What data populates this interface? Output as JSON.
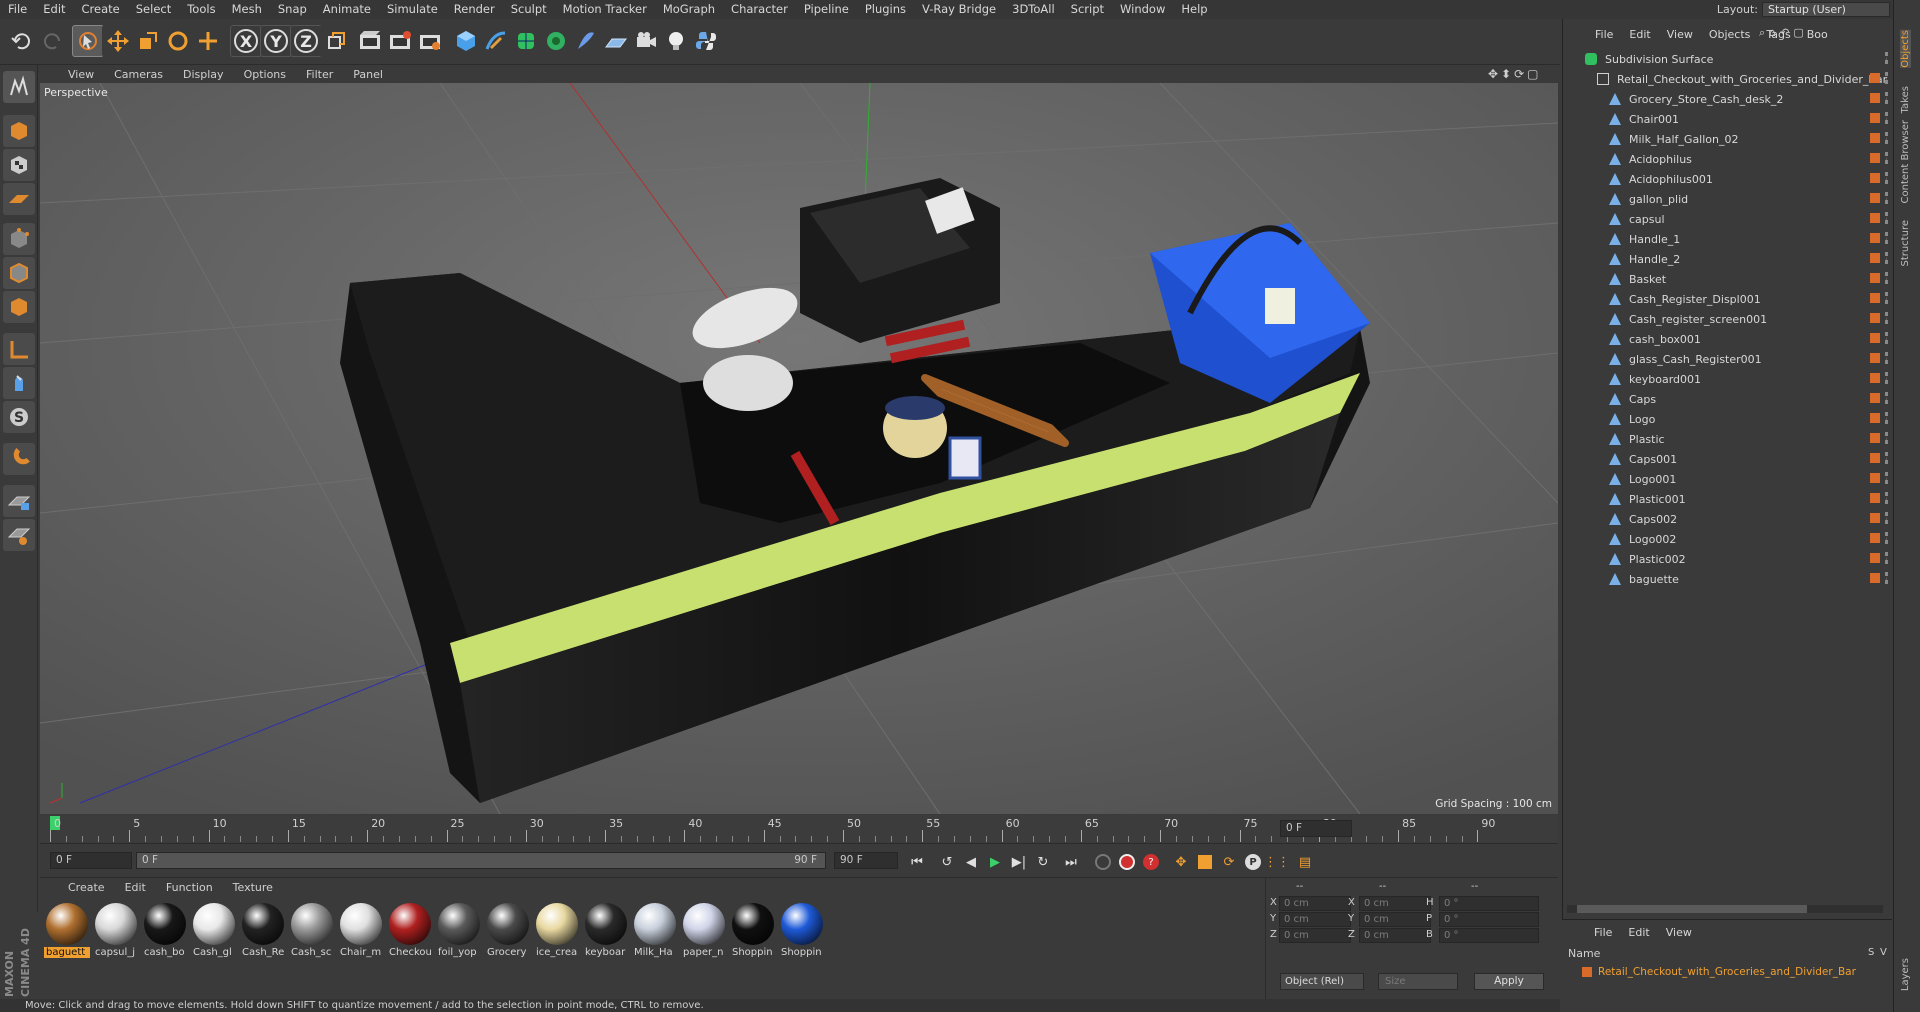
{
  "menubar": {
    "items": [
      "File",
      "Edit",
      "Create",
      "Select",
      "Tools",
      "Mesh",
      "Snap",
      "Animate",
      "Simulate",
      "Render",
      "Sculpt",
      "Motion Tracker",
      "MoGraph",
      "Character",
      "Pipeline",
      "Plugins",
      "V-Ray Bridge",
      "3DToAll",
      "Script",
      "Window",
      "Help"
    ],
    "layout_label": "Layout:",
    "layout_value": "Startup (User)"
  },
  "toolbar": {
    "axis_x": "X",
    "axis_y": "Y",
    "axis_z": "Z"
  },
  "viewport": {
    "menu": [
      "View",
      "Cameras",
      "Display",
      "Options",
      "Filter",
      "Panel"
    ],
    "camera_label": "Perspective",
    "grid_spacing": "Grid Spacing : 100 cm"
  },
  "timeline": {
    "ticks": [
      "0",
      "5",
      "10",
      "15",
      "20",
      "25",
      "30",
      "35",
      "40",
      "45",
      "50",
      "55",
      "60",
      "65",
      "70",
      "75",
      "80",
      "85",
      "90"
    ],
    "current_frame": "0 F",
    "start_field": "0 F",
    "range_start": "0 F",
    "range_end": "90 F",
    "end_field": "90 F"
  },
  "materials": {
    "menu": [
      "Create",
      "Edit",
      "Function",
      "Texture"
    ],
    "items": [
      {
        "name": "baguett",
        "color": "#b07030",
        "selected": true
      },
      {
        "name": "capsul_j",
        "color": "#d8d8d8",
        "selected": false
      },
      {
        "name": "cash_bo",
        "color": "#181818",
        "selected": false
      },
      {
        "name": "Cash_gl",
        "color": "#e8e8e8",
        "selected": false
      },
      {
        "name": "Cash_Re",
        "color": "#222222",
        "selected": false
      },
      {
        "name": "Cash_sc",
        "color": "#9a9a9a",
        "selected": false
      },
      {
        "name": "Chair_m",
        "color": "#e0e0e0",
        "selected": false
      },
      {
        "name": "Checkou",
        "color": "#b02020",
        "selected": false
      },
      {
        "name": "foil_yop",
        "color": "#5a5a5a",
        "selected": false
      },
      {
        "name": "Grocery",
        "color": "#4a4a4a",
        "selected": false
      },
      {
        "name": "ice_crea",
        "color": "#e8d8a0",
        "selected": false
      },
      {
        "name": "keyboar",
        "color": "#2a2a2a",
        "selected": false
      },
      {
        "name": "Milk_Ha",
        "color": "#c8d0dc",
        "selected": false
      },
      {
        "name": "paper_n",
        "color": "#d0d4e8",
        "selected": false
      },
      {
        "name": "Shoppin",
        "color": "#101010",
        "selected": false
      },
      {
        "name": "Shoppin",
        "color": "#1e5ad8",
        "selected": false
      }
    ]
  },
  "coords": {
    "head": [
      "--",
      "--",
      "--"
    ],
    "rows": [
      {
        "a": "X",
        "av": "0 cm",
        "b": "X",
        "bv": "0 cm",
        "c": "H",
        "cv": "0 °"
      },
      {
        "a": "Y",
        "av": "0 cm",
        "b": "Y",
        "bv": "0 cm",
        "c": "P",
        "cv": "0 °"
      },
      {
        "a": "Z",
        "av": "0 cm",
        "b": "Z",
        "bv": "0 cm",
        "c": "B",
        "cv": "0 °"
      }
    ],
    "mode": "Object (Rel)",
    "size": "Size",
    "apply": "Apply"
  },
  "status": "Move: Click and drag to move elements. Hold down SHIFT to quantize movement / add to the selection in point mode, CTRL to remove.",
  "objects": {
    "menu": [
      "File",
      "Edit",
      "View",
      "Objects",
      "Tags",
      "Boo"
    ],
    "root": "Subdivision Surface",
    "group": "Retail_Checkout_with_Groceries_and_Divider_Bar",
    "children": [
      "Grocery_Store_Cash_desk_2",
      "Chair001",
      "Milk_Half_Gallon_02",
      "Acidophilus",
      "Acidophilus001",
      "gallon_plid",
      "capsul",
      "Handle_1",
      "Handle_2",
      "Basket",
      "Cash_Register_Displ001",
      "Cash_register_screen001",
      "cash_box001",
      "glass_Cash_Register001",
      "keyboard001",
      "Caps",
      "Logo",
      "Plastic",
      "Caps001",
      "Logo001",
      "Plastic001",
      "Caps002",
      "Logo002",
      "Plastic002",
      "baguette"
    ]
  },
  "layers": {
    "menu": [
      "File",
      "Edit",
      "View"
    ],
    "col_name": "Name",
    "col_s": "S",
    "col_v": "V",
    "item": "Retail_Checkout_with_Groceries_and_Divider_Bar"
  },
  "side_tabs": [
    "Objects",
    "Takes",
    "Content Browser",
    "Structure",
    "Layers"
  ],
  "brand": "MAXON CINEMA 4D"
}
